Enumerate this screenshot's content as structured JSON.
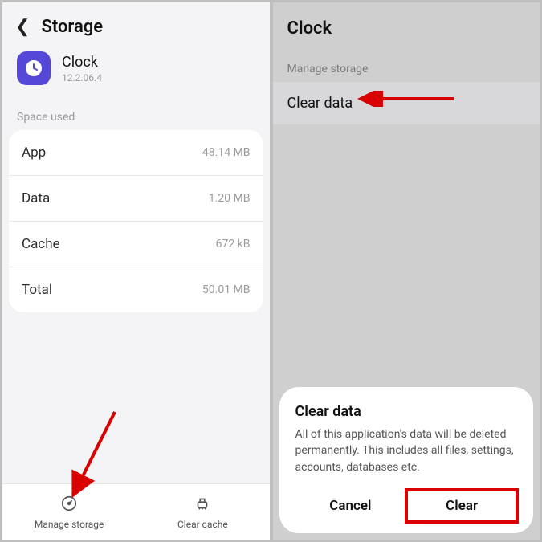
{
  "left": {
    "title": "Storage",
    "app": {
      "name": "Clock",
      "version": "12.2.06.4"
    },
    "section_label": "Space used",
    "rows": [
      {
        "label": "App",
        "value": "48.14 MB"
      },
      {
        "label": "Data",
        "value": "1.20 MB"
      },
      {
        "label": "Cache",
        "value": "672 kB"
      },
      {
        "label": "Total",
        "value": "50.01 MB"
      }
    ],
    "tabs": {
      "manage": "Manage storage",
      "clear_cache": "Clear cache"
    }
  },
  "right": {
    "title": "Clock",
    "section_label": "Manage storage",
    "clear_data_row": "Clear data",
    "dialog": {
      "title": "Clear data",
      "body": "All of this application's data will be deleted permanently. This includes all files, settings, accounts, databases etc.",
      "cancel": "Cancel",
      "clear": "Clear"
    }
  }
}
